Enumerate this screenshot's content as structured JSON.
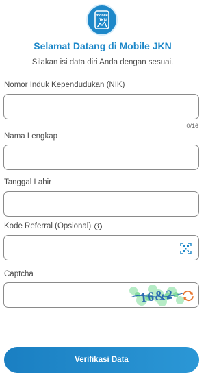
{
  "header": {
    "logo_text": "Mobile JKN",
    "title": "Selamat Datang di Mobile JKN",
    "subtitle": "Silakan isi data diri Anda dengan sesuai."
  },
  "form": {
    "nik": {
      "label": "Nomor Induk Kependudukan (NIK)",
      "value": "",
      "counter": "0/16"
    },
    "name": {
      "label": "Nama Lengkap",
      "value": ""
    },
    "dob": {
      "label": "Tanggal Lahir",
      "value": ""
    },
    "referral": {
      "label": "Kode Referral (Opsional)",
      "value": "",
      "info_icon": "info-icon",
      "scan_icon": "qr-scan-icon"
    },
    "captcha": {
      "label": "Captcha",
      "value": "",
      "image_text": "16&2",
      "refresh_icon": "refresh-icon"
    }
  },
  "submit_label": "Verifikasi Data",
  "colors": {
    "brand": "#1e88c9",
    "border": "#8a8a8a",
    "text": "#4a4a4a"
  }
}
